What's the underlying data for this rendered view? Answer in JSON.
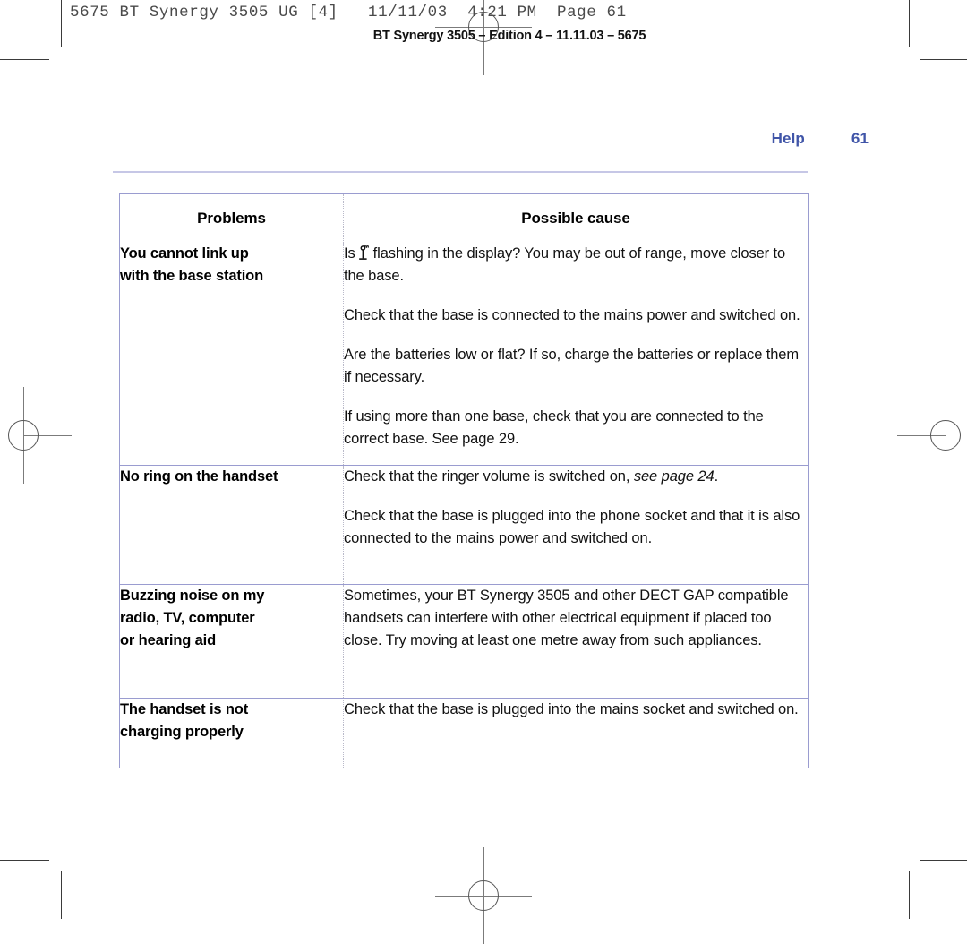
{
  "printer_header": "5675 BT Synergy 3505 UG [4]   11/11/03  4:21 PM  Page 61",
  "edition_line": "BT Synergy 3505 – Edition 4 – 11.11.03 – 5675",
  "running_head": {
    "label": "Help",
    "page_number": "61",
    "color": "#4055a8"
  },
  "table": {
    "headers": {
      "problems": "Problems",
      "possible_cause": "Possible cause"
    },
    "rows": [
      {
        "problem": "You cannot link up with the base station",
        "problem_lines": [
          "You cannot link up",
          "with the base station"
        ],
        "icon": "antenna-signal-icon",
        "paragraphs": [
          {
            "before_icon": "Is",
            "after_icon": "flashing in the display?  You may be out of range, move closer to the base."
          },
          {
            "text": "Check that the base is connected to the mains power and switched on."
          },
          {
            "text": "Are the batteries low or flat? If so, charge the batteries or replace them if necessary."
          },
          {
            "text": "If using more than one base, check that you are connected to the correct base. See page 29."
          }
        ]
      },
      {
        "problem": "No ring on the handset",
        "problem_lines": [
          "No ring on the handset"
        ],
        "paragraphs": [
          {
            "text": "Check that the ringer volume is switched on, ",
            "italic": "see page 24",
            "tail": "."
          },
          {
            "text": "Check that the base is plugged into the phone socket and that it is also connected to the mains power and switched on."
          }
        ]
      },
      {
        "problem": "Buzzing noise on my radio, TV, computer or hearing aid",
        "problem_lines": [
          "Buzzing noise on my",
          "radio, TV, computer",
          "or hearing aid"
        ],
        "paragraphs": [
          {
            "text": "Sometimes, your BT Synergy 3505 and other DECT GAP compatible handsets can interfere with other electrical equipment if placed too close. Try moving at least one metre away from such appliances."
          }
        ]
      },
      {
        "problem": "The handset is not charging properly",
        "problem_lines": [
          "The handset is not",
          "charging properly"
        ],
        "paragraphs": [
          {
            "text": "Check that the base is plugged into the mains socket and switched on."
          }
        ]
      }
    ],
    "border_color": "#9a9cd0",
    "divider_color": "#b9b9c9"
  },
  "rule_color": "#c6c7e6"
}
